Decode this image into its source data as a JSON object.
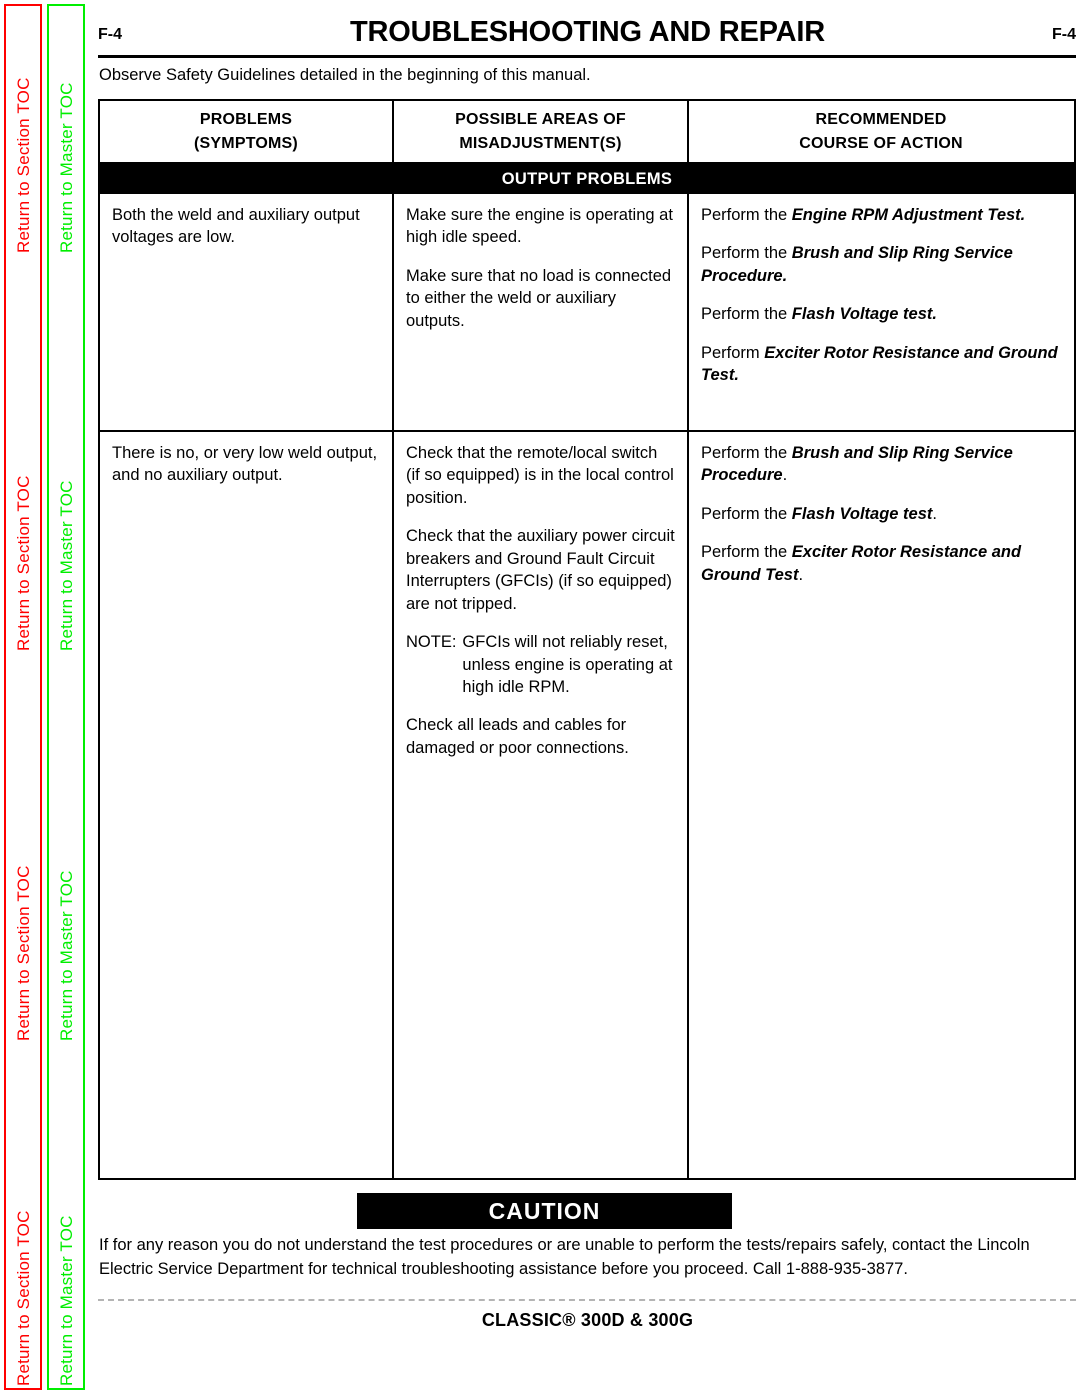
{
  "sidebar": {
    "section_tab": {
      "label": "Return to Section TOC",
      "color": "#ff0000",
      "repeats": [
        "Return to Section TOC",
        "Return to Section TOC",
        "Return to Section TOC",
        "Return to Section TOC"
      ]
    },
    "master_tab": {
      "label": "Return to Master TOC",
      "color": "#00ee00",
      "repeats": [
        "Return to Master TOC",
        "Return to Master TOC",
        "Return to Master TOC",
        "Return to Master TOC"
      ]
    }
  },
  "header": {
    "page_number_left": "F-4",
    "page_number_right": "F-4",
    "title": "TROUBLESHOOTING AND REPAIR"
  },
  "intro": {
    "observe": "Observe Safety Guidelines detailed in the beginning of this manual."
  },
  "table": {
    "headers": {
      "col1_line1": "PROBLEMS",
      "col1_line2": "(SYMPTOMS)",
      "col2_line1": "POSSIBLE AREAS OF",
      "col2_line2": "MISADJUSTMENT(S)",
      "col3_line1": "RECOMMENDED",
      "col3_line2": "COURSE OF ACTION"
    },
    "section_band": "OUTPUT PROBLEMS",
    "rows": [
      {
        "symptom": "Both the weld and auxiliary output voltages are low.",
        "areas": [
          "Make sure the engine is operating at high idle speed.",
          "Make sure that no load is connected to either the weld or auxiliary outputs."
        ],
        "actions": [
          {
            "lead": "Perform the ",
            "emphasis": "Engine RPM Adjustment Test.",
            "tail": ""
          },
          {
            "lead": "Perform the ",
            "emphasis": "Brush and Slip Ring Service Procedure.",
            "tail": ""
          },
          {
            "lead": "Perform the ",
            "emphasis": "Flash Voltage test.",
            "tail": ""
          },
          {
            "lead": "Perform ",
            "emphasis": "Exciter Rotor Resistance and Ground Test.",
            "tail": ""
          }
        ]
      },
      {
        "symptom": "There is no, or very low weld output, and no auxiliary output.",
        "areas": [
          "Check that the remote/local switch (if so equipped) is in the local control position.",
          "Check that the auxiliary power circuit breakers and Ground Fault Circuit Interrupters (GFCIs) (if so equipped) are not tripped.",
          "Check all leads and cables for damaged or poor connections."
        ],
        "note": {
          "lead": "NOTE:",
          "body": "GFCIs will not reliably reset, unless engine is operating at high idle RPM."
        },
        "actions": [
          {
            "lead": "Perform the ",
            "emphasis": "Brush and Slip Ring Service Procedure",
            "tail": "."
          },
          {
            "lead": "Perform the ",
            "emphasis": "Flash Voltage test",
            "tail": "."
          },
          {
            "lead": "Perform the ",
            "emphasis": "Exciter Rotor Resistance and Ground Test",
            "tail": "."
          }
        ]
      }
    ]
  },
  "caution": {
    "title": "CAUTION",
    "body": "If for any reason you do not understand the test procedures or are unable to perform the tests/repairs safely, contact the Lincoln Electric Service Department for technical troubleshooting assistance before you proceed. Call 1-888-935-3877."
  },
  "footer": {
    "product": "CLASSIC® 300D & 300G"
  }
}
